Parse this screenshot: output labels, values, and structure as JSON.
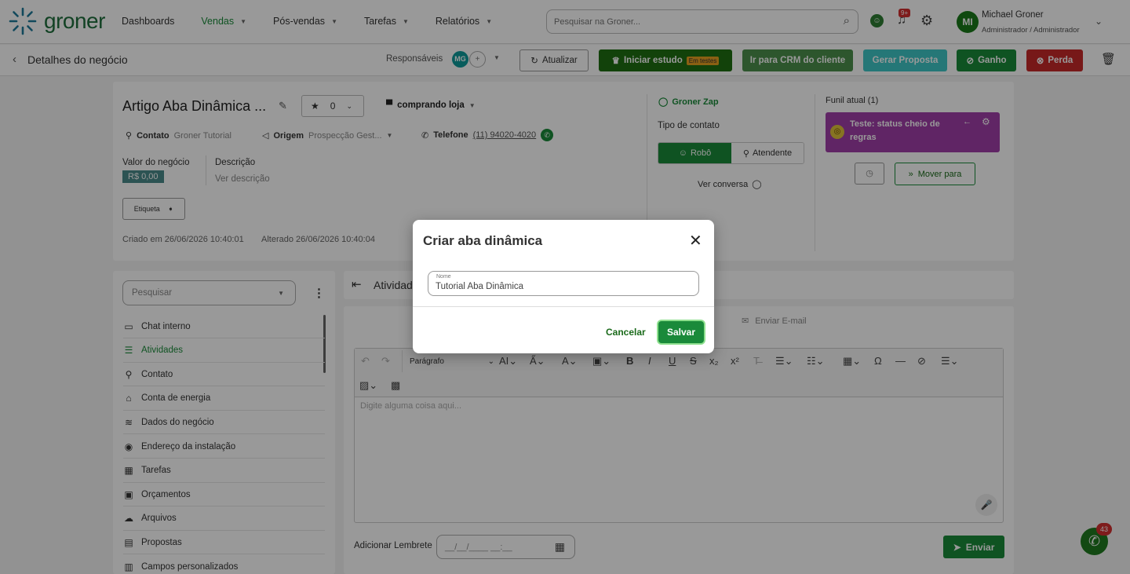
{
  "nav": {
    "logo": "groner",
    "items": [
      {
        "label": "Dashboards",
        "caret": false,
        "active": false
      },
      {
        "label": "Vendas",
        "caret": true,
        "active": true
      },
      {
        "label": "Pós-vendas",
        "caret": true,
        "active": false
      },
      {
        "label": "Tarefas",
        "caret": true,
        "active": false
      },
      {
        "label": "Relatórios",
        "caret": true,
        "active": false
      }
    ],
    "search_placeholder": "Pesquisar na Groner...",
    "notif_badge": "9+",
    "user_initials": "MI",
    "user_name": "Michael Groner",
    "user_role": "Administrador / Administrador"
  },
  "subheader": {
    "title": "Detalhes do negócio",
    "responsaveis_label": "Responsáveis",
    "resp_initials": "MG",
    "btn_atualizar": "Atualizar",
    "btn_iniciar": "Iniciar estudo",
    "btn_iniciar_badge": "Em testes",
    "btn_crm": "Ir para CRM do cliente",
    "btn_proposta": "Gerar Proposta",
    "btn_ganho": "Ganho",
    "btn_perda": "Perda"
  },
  "deal": {
    "title": "Artigo Aba Dinâmica ...",
    "rating": "0",
    "stage": "comprando loja",
    "contato_label": "Contato",
    "contato_value": "Groner Tutorial",
    "origem_label": "Origem",
    "origem_value": "Prospecção Gest...",
    "telefone_label": "Telefone",
    "telefone_value": "(11) 94020-4020",
    "valor_label": "Valor do negócio",
    "valor_value": "R$ 0,00",
    "descricao_label": "Descrição",
    "descricao_value": "Ver descrição",
    "etiqueta": "Etiqueta",
    "criado": "Criado em 26/06/2026 10:40:01",
    "alterado": "Alterado 26/06/2026 10:40:04"
  },
  "contact_panel": {
    "zap": "Groner Zap",
    "tipo_label": "Tipo de contato",
    "robo": "Robô",
    "atendente": "Atendente",
    "ver_conversa": "Ver conversa"
  },
  "funnel": {
    "title": "Funil atual (1)",
    "stage_name": "Teste: status cheio de regras",
    "mover": "Mover para"
  },
  "sidebar": {
    "search_placeholder": "Pesquisar",
    "items": [
      {
        "label": "Chat interno",
        "icon": "chat-icon",
        "glyph": "▭",
        "active": false
      },
      {
        "label": "Atividades",
        "icon": "activities-icon",
        "glyph": "☰",
        "active": true
      },
      {
        "label": "Contato",
        "icon": "person-icon",
        "glyph": "⚲",
        "active": false
      },
      {
        "label": "Conta de energia",
        "icon": "home-icon",
        "glyph": "⌂",
        "active": false
      },
      {
        "label": "Dados do negócio",
        "icon": "database-icon",
        "glyph": "≋",
        "active": false
      },
      {
        "label": "Endereço da instalação",
        "icon": "location-icon",
        "glyph": "◉",
        "active": false
      },
      {
        "label": "Tarefas",
        "icon": "calendar-icon",
        "glyph": "▦",
        "active": false
      },
      {
        "label": "Orçamentos",
        "icon": "budget-icon",
        "glyph": "▣",
        "active": false
      },
      {
        "label": "Arquivos",
        "icon": "cloud-icon",
        "glyph": "☁",
        "active": false
      },
      {
        "label": "Propostas",
        "icon": "document-icon",
        "glyph": "▤",
        "active": false
      },
      {
        "label": "Campos personalizados",
        "icon": "fields-icon",
        "glyph": "▥",
        "active": false
      }
    ]
  },
  "main": {
    "header": "Atividades",
    "tab_email": "Enviar E-mail",
    "paragraph_select": "Parágrafo",
    "editor_placeholder": "Digite alguma coisa aqui...",
    "lembrete_label": "Adicionar Lembrete",
    "lembrete_placeholder": "__/__/____ __:__",
    "enviar": "Enviar"
  },
  "whatsapp_badge": "43",
  "modal": {
    "title": "Criar aba dinâmica",
    "field_label": "Nome",
    "field_value": "Tutorial Aba Dinâmica",
    "cancel": "Cancelar",
    "save": "Salvar"
  },
  "colors": {
    "brand_green": "#1a8a3a",
    "dark_green": "#1f7a1f",
    "teal": "#3ec6c6",
    "red": "#c62828",
    "purple": "#a13ea8"
  }
}
